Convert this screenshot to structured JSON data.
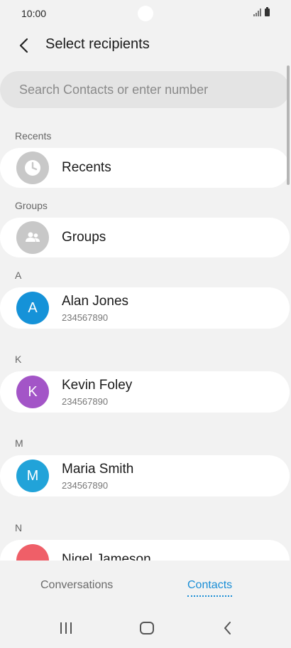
{
  "status_bar": {
    "time": "10:00",
    "signal_icon": "signal-icon",
    "battery_icon": "battery-icon"
  },
  "header": {
    "title": "Select recipients",
    "back_icon": "back-arrow-icon"
  },
  "search": {
    "placeholder": "Search Contacts or enter number"
  },
  "list": {
    "sections": [
      {
        "label": "Recents",
        "items": [
          {
            "name": "Recents",
            "icon": "clock-icon",
            "color": "#c8c8c8"
          }
        ]
      },
      {
        "label": "Groups",
        "items": [
          {
            "name": "Groups",
            "icon": "people-icon",
            "color": "#c8c8c8"
          }
        ]
      },
      {
        "label": "A",
        "items": [
          {
            "initial": "A",
            "name": "Alan Jones",
            "number": "234567890",
            "color": "#1592d8"
          }
        ]
      },
      {
        "label": "K",
        "items": [
          {
            "initial": "K",
            "name": "Kevin Foley",
            "number": "234567890",
            "color": "#a355c7"
          }
        ]
      },
      {
        "label": "M",
        "items": [
          {
            "initial": "M",
            "name": "Maria Smith",
            "number": "234567890",
            "color": "#21a3d9"
          }
        ]
      },
      {
        "label": "N",
        "items": [
          {
            "name": "Nigel Jameson",
            "color": "#ef5f68"
          }
        ]
      }
    ]
  },
  "tabs": [
    {
      "label": "Conversations",
      "active": false
    },
    {
      "label": "Contacts",
      "active": true
    }
  ],
  "nav": {
    "recent_apps_icon": "recent-apps-icon",
    "home_icon": "home-icon",
    "back_icon": "nav-back-icon"
  }
}
